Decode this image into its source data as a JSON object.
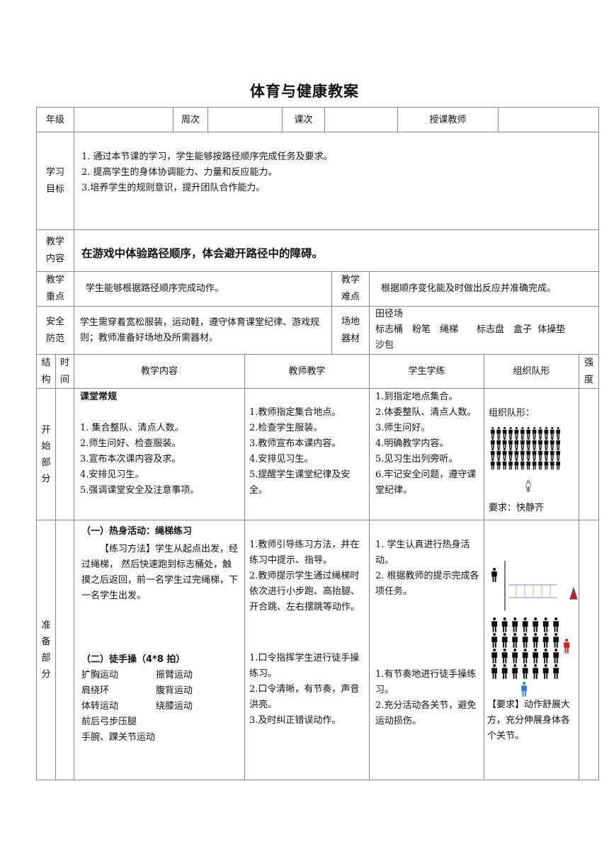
{
  "title": "体育与健康教案",
  "header_row": {
    "grade_label": "年级",
    "grade_value": "",
    "week_label": "周次",
    "week_value": "",
    "lesson_label": "课次",
    "lesson_value": "",
    "teacher_label": "授课教师",
    "teacher_value": ""
  },
  "goals": {
    "label": "学习目标",
    "items": [
      "1.  通过本节课的学习，学生能够按路径顺序完成任务及要求。",
      "2.  提高学生的身体协调能力、力量和反应能力。",
      "3.培养学生的规则意识，提升团队合作能力。"
    ]
  },
  "content": {
    "label": "教学内容",
    "text": "在游戏中体验路径顺序，体会避开路径中的障碍。"
  },
  "key_points": {
    "label": "教学重点",
    "text": "学生能够根据路径顺序完成动作。",
    "difficulty_label": "教学难点",
    "difficulty_text": "根据顺序变化能及时做出反应并准确完成。"
  },
  "safety": {
    "label": "安全防范",
    "text": "学生需穿着宽松服装，运动鞋，遵守体育课堂纪律、游戏规则；教师准备好场地及所需器材。",
    "venue_label": "场地器材",
    "venue_lines": [
      "田径场",
      "标志桶　粉笔　绳梯　　标志盘　盒子  体操垫",
      "沙包"
    ]
  },
  "columns": {
    "structure": "结构",
    "time": "时间",
    "content": "教学内容",
    "teacher": "教师教学",
    "student": "学生学练",
    "formation": "组织队形",
    "intensity": "强度"
  },
  "sections": [
    {
      "name": "开始部分",
      "time": "",
      "content_title": "课堂常规",
      "content_items": [
        "1.  集合整队、清点人数。",
        "2.师生问好、检查服装。",
        "3.宣布本次课内容及求。",
        "4.安排见习生。",
        "5.强调课堂安全及注意事项。"
      ],
      "teacher_items": [
        "1.教师指定集合地点。",
        "2.检查学生服装。",
        "3.教师宣布本课内容。",
        "4.安排见习生。",
        "5.提醒学生课堂纪律及安全。"
      ],
      "student_items": [
        "1.到指定地点集合。",
        "2.体委整队、清点人数。",
        "3.师生问好。",
        "4.明确教学内容。",
        "5.见习生出列旁听。",
        "6.牢记安全问题，遵守课堂纪律。"
      ],
      "formation_label": "组织队形：",
      "formation_rows": 4,
      "formation_cols": 12,
      "formation_requirement": "要求：快静齐",
      "intensity": ""
    },
    {
      "name": "准备部分",
      "time": "",
      "warmup_title": "（一）热身活动：绳梯练习",
      "warmup_method": "【练习方法】学生从起点出发，经过绳梯， 然后快速跑到标志桶处，触摸之后返回，前一名学生过完绳梯，下一名学生出发。",
      "exercise_title": "（二）徒手操（4*8 拍）",
      "exercise_pairs": [
        [
          "扩胸运动",
          "振臂运动"
        ],
        [
          "肩绕环",
          "腹背运动"
        ],
        [
          "体转运动",
          "绕膝运动"
        ]
      ],
      "exercise_singles": [
        "前后弓步压腿",
        "手腕、踝关节运动"
      ],
      "teacher_items_1": [
        "1.教师引导练习方法，并在练习中提示、指导。",
        "2.教师提示学生通过绳梯时依次进行小步跑、高抬腿、开合跳、左右摆跳等动作。"
      ],
      "teacher_items_2": [
        "1.口令指挥学生进行徒手操练习。",
        "2.口令清晰，有节奏，声音洪亮。",
        "3.及时纠正错误动作。"
      ],
      "student_items_1": [
        "1.  学生认真进行热身活动。",
        "2.  根据教师的提示完成各项任务。"
      ],
      "student_items_2": [
        "1.有节奏地进行徒手操练习。",
        "2.充分活动各关节，避免运动损伤。"
      ],
      "formation_rows": 4,
      "formation_cols": 7,
      "ladder_rungs": 5,
      "formation_requirement": "【要求】动作舒展大方，充分伸展身体各个关节。",
      "intensity": "",
      "colors": {
        "leader": "#e8141c",
        "teacher": "#2a7fd0",
        "ladder_rail": "#7aaee0",
        "ladder_rung": "#f0a060",
        "cone": "#e81010",
        "cone_edge": "#3050a0"
      }
    }
  ]
}
